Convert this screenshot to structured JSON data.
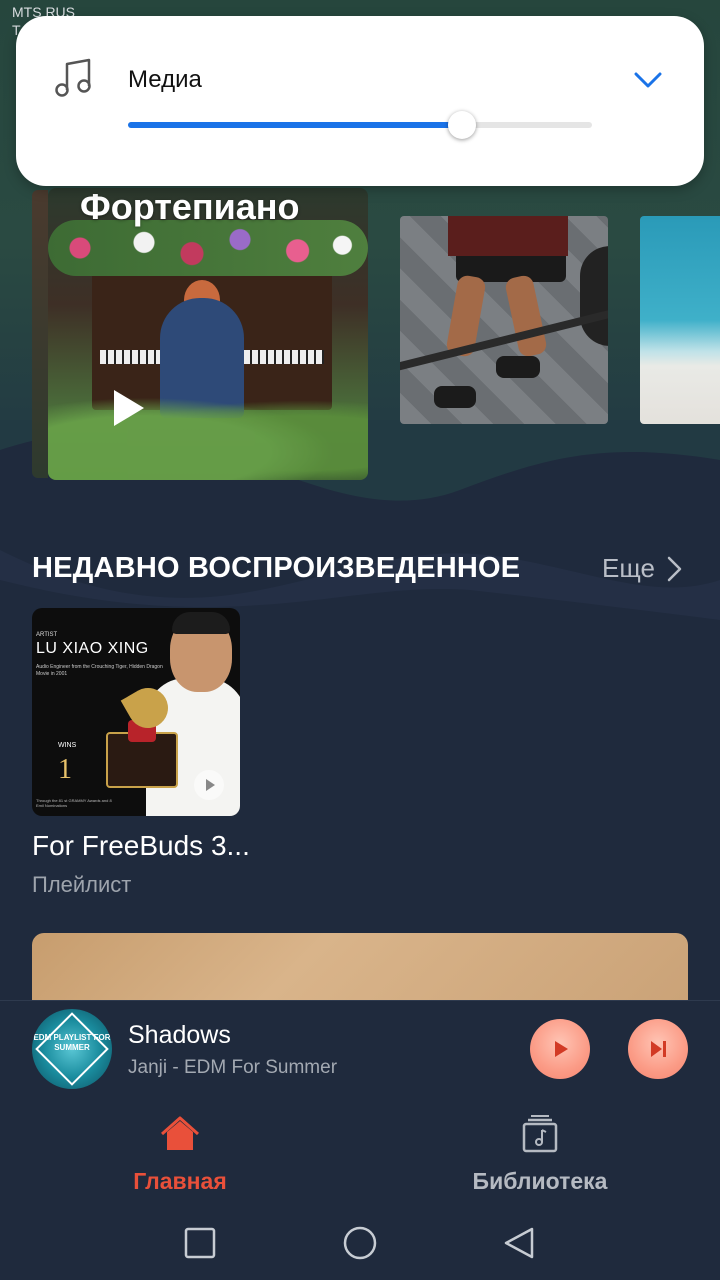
{
  "status_bar": {
    "carrier": "MTS RUS",
    "carrier_line2": "T"
  },
  "volume_panel": {
    "label": "Медиа",
    "level_fraction": 0.72,
    "icon": "music-note-icon",
    "collapse_icon": "chevron-down-icon",
    "accent_color": "#1a73e8"
  },
  "featured": {
    "main_title": "Фортепиано",
    "cards": [
      "piano-cover",
      "gym-cover",
      "beach-cover"
    ]
  },
  "recent": {
    "section_title": "НЕДАВНО ВОСПРОИЗВЕДЕННОЕ",
    "more_label": "Еще",
    "items": [
      {
        "title": "For FreeBuds 3...",
        "subtitle": "Плейлист",
        "cover": {
          "tag": "ARTIST",
          "artist": "LU XIAO XING",
          "sub": "Audio Engineer from the Crouching Tiger, Hidden Dragon Movie in 2001",
          "wins_label": "WINS",
          "wins_number": "1",
          "fineprint": "Through the 81 st GRAMMY Awards and 8 Emil Nominations"
        }
      }
    ]
  },
  "mini_player": {
    "song": "Shadows",
    "artist": "Janji - EDM For Summer",
    "cover_text": "EDM PLAYLIST FOR SUMMER",
    "accent_color": "#f58570"
  },
  "tabs": [
    {
      "label": "Главная",
      "icon": "home-icon",
      "active": true,
      "color": "#e9503a"
    },
    {
      "label": "Библиотека",
      "icon": "library-icon",
      "active": false,
      "color": "#b5bac2"
    }
  ]
}
